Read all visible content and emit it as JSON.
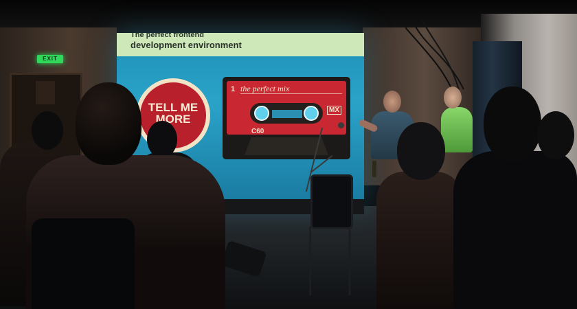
{
  "scene": {
    "exit_sign": "EXIT",
    "slide": {
      "title_line_1": "The perfect frontend",
      "title_line_2": "development environment",
      "badge_text": "TELL ME MORE",
      "cassette": {
        "number": "1",
        "title": "the perfect mix",
        "type": "C60",
        "brand": "MX"
      }
    }
  },
  "colors": {
    "slide_background": "#2aa3c9",
    "slide_header": "#cfe8b9",
    "badge_red": "#b8202c",
    "cassette_red": "#c92832",
    "exit_green": "#2fd85a",
    "speaker_shirt_green": "#89d66a"
  }
}
